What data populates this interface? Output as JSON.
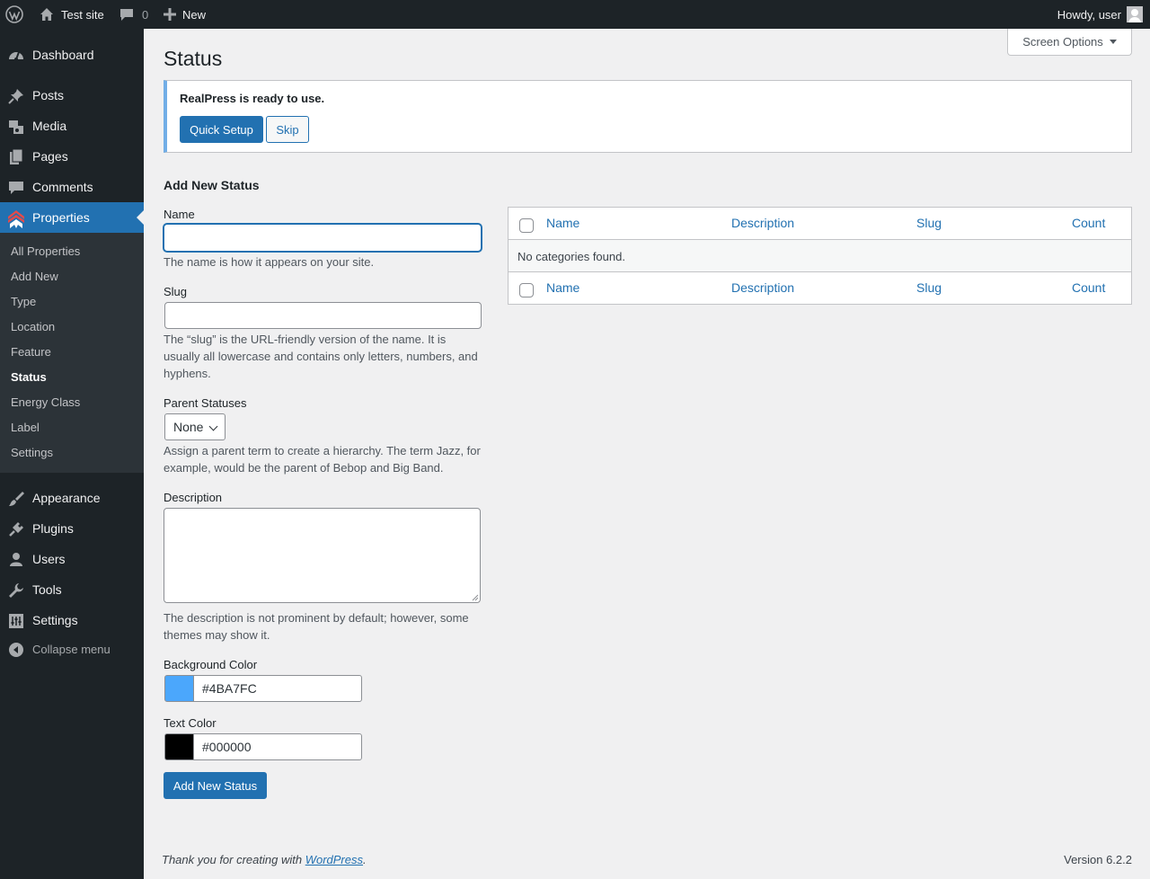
{
  "admin_bar": {
    "site_name": "Test site",
    "comments_count": "0",
    "new_label": "New",
    "howdy": "Howdy, user"
  },
  "sidebar": {
    "top_items": [
      {
        "label": "Dashboard",
        "icon": "dashboard-icon"
      },
      {
        "label": "Posts",
        "icon": "pin-icon"
      },
      {
        "label": "Media",
        "icon": "media-icon"
      },
      {
        "label": "Pages",
        "icon": "pages-icon"
      },
      {
        "label": "Comments",
        "icon": "comment-icon"
      },
      {
        "label": "Properties",
        "icon": "realpress-logo-icon"
      }
    ],
    "submenu": [
      "All Properties",
      "Add New",
      "Type",
      "Location",
      "Feature",
      "Status",
      "Energy Class",
      "Label",
      "Settings"
    ],
    "current_submenu": "Status",
    "bottom_items": [
      {
        "label": "Appearance",
        "icon": "brush-icon"
      },
      {
        "label": "Plugins",
        "icon": "plug-icon"
      },
      {
        "label": "Users",
        "icon": "users-icon"
      },
      {
        "label": "Tools",
        "icon": "wrench-icon"
      },
      {
        "label": "Settings",
        "icon": "settings-icon"
      }
    ],
    "collapse_label": "Collapse menu",
    "accent_color": "#2271b1"
  },
  "header": {
    "title": "Status",
    "screen_options": "Screen Options"
  },
  "notice": {
    "text": "RealPress is ready to use.",
    "quick_setup": "Quick Setup",
    "skip": "Skip"
  },
  "form": {
    "title": "Add New Status",
    "name_label": "Name",
    "name_value": "",
    "name_help": "The name is how it appears on your site.",
    "slug_label": "Slug",
    "slug_value": "",
    "slug_help": "The “slug” is the URL-friendly version of the name. It is usually all lowercase and contains only letters, numbers, and hyphens.",
    "parent_label": "Parent Statuses",
    "parent_selected": "None",
    "parent_help": "Assign a parent term to create a hierarchy. The term Jazz, for example, would be the parent of Bebop and Big Band.",
    "description_label": "Description",
    "description_value": "",
    "description_help": "The description is not prominent by default; however, some themes may show it.",
    "bg_color_label": "Background Color",
    "bg_color_value": "#4BA7FC",
    "text_color_label": "Text Color",
    "text_color_value": "#000000",
    "submit": "Add New Status"
  },
  "table": {
    "columns": [
      "Name",
      "Description",
      "Slug",
      "Count"
    ],
    "empty_message": "No categories found."
  },
  "footer": {
    "thanks_prefix": "Thank you for creating with ",
    "link_text": "WordPress",
    "suffix": ".",
    "version": "Version 6.2.2"
  }
}
